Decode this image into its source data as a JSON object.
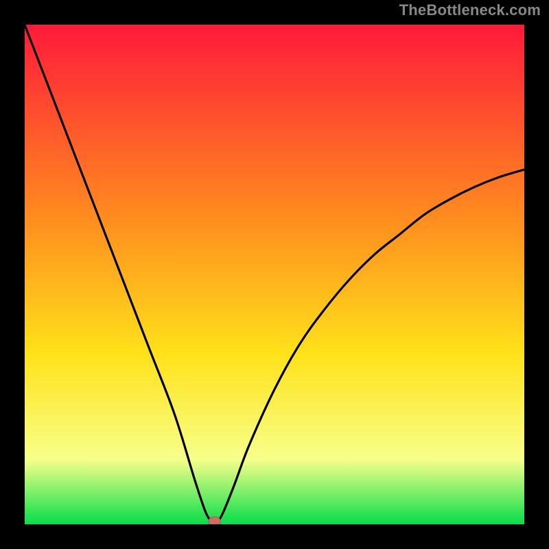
{
  "watermark": "TheBottleneck.com",
  "colors": {
    "frame": "#000000",
    "gradient_top": "#ff1a3a",
    "gradient_mid1": "#ff8a1f",
    "gradient_mid2": "#ffe21a",
    "gradient_mid3": "#f7ff8a",
    "gradient_bottom": "#07de4a",
    "curve": "#000000",
    "marker_fill": "#c97064",
    "marker_stroke": "#b05a50"
  },
  "chart_data": {
    "type": "line",
    "title": "",
    "xlabel": "",
    "ylabel": "",
    "xlim": [
      0,
      100
    ],
    "ylim": [
      0,
      100
    ],
    "left_branch": {
      "x": [
        0,
        5,
        10,
        15,
        20,
        25,
        30,
        34,
        36,
        37,
        38
      ],
      "y": [
        100,
        87,
        74,
        61,
        48,
        35,
        22,
        9,
        3,
        1,
        0
      ]
    },
    "right_branch": {
      "x": [
        38,
        39,
        40,
        42,
        45,
        50,
        55,
        60,
        65,
        70,
        75,
        80,
        85,
        90,
        95,
        100
      ],
      "y": [
        0,
        1,
        3,
        8,
        16,
        27,
        36,
        43,
        49,
        54,
        58,
        62,
        65,
        67.5,
        69.5,
        71
      ]
    },
    "marker": {
      "x": 38,
      "y": 0
    }
  }
}
